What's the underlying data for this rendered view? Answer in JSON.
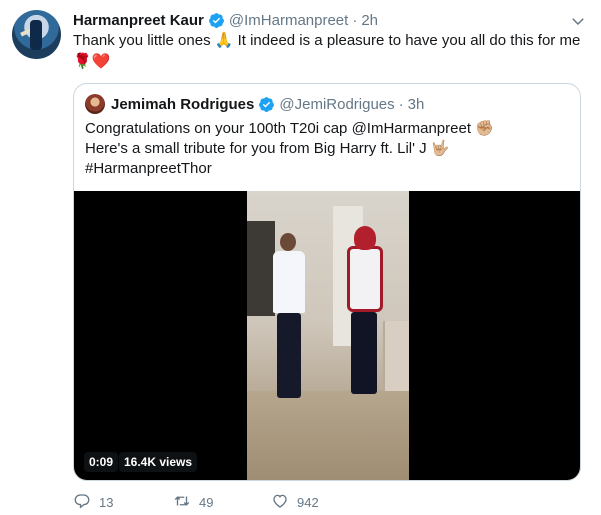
{
  "tweet": {
    "author_name": "Harmanpreet Kaur",
    "author_handle": "@ImHarmanpreet",
    "separator": "·",
    "time": "2h",
    "text": "Thank you little ones 🙏 It indeed is a pleasure to have you all do this for me",
    "emojis": "🌹❤️"
  },
  "quoted": {
    "author_name": "Jemimah Rodrigues",
    "author_handle": "@JemiRodrigues",
    "separator": "·",
    "time": "3h",
    "lines": [
      "Congratulations on your 100th T20i cap @ImHarmanpreet ✊🏼",
      "Here's a small tribute for you from Big Harry ft. Lil' J 🤟🏼",
      "#HarmanpreetThor"
    ],
    "video": {
      "duration": "0:09",
      "views": "16.4K views"
    }
  },
  "actions": {
    "reply_count": "13",
    "retweet_count": "49",
    "like_count": "942"
  },
  "colors": {
    "verified": "#1da1f2",
    "secondary_text": "#657786",
    "border": "#ccd6dd"
  },
  "icons": [
    "verified-badge-icon",
    "chevron-down-icon",
    "reply-icon",
    "retweet-icon",
    "like-icon"
  ]
}
